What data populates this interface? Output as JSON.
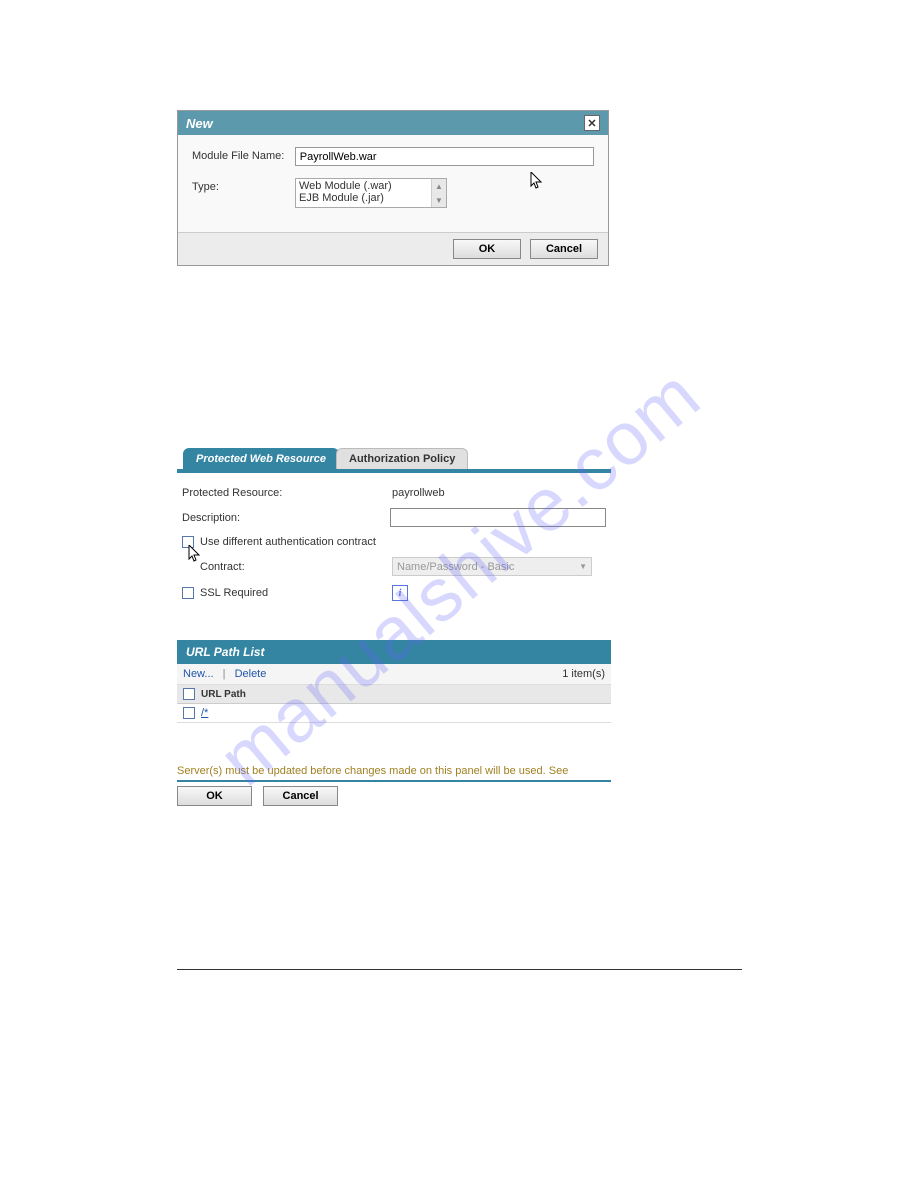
{
  "watermark": "manualshive.com",
  "dialog": {
    "title": "New",
    "fields": {
      "module_file_name": {
        "label": "Module File Name:",
        "value": "PayrollWeb.war"
      },
      "type": {
        "label": "Type:",
        "options": [
          "Web Module (.war)",
          "EJB Module (.jar)"
        ]
      }
    },
    "buttons": {
      "ok": "OK",
      "cancel": "Cancel"
    }
  },
  "tabs": {
    "active": "Protected Web Resource",
    "inactive": "Authorization Policy"
  },
  "resource_form": {
    "protected_resource": {
      "label": "Protected Resource:",
      "value": "payrollweb"
    },
    "description": {
      "label": "Description:",
      "value": ""
    },
    "use_contract": "Use different authentication contract",
    "contract": {
      "label": "Contract:",
      "value": "Name/Password - Basic"
    },
    "ssl": "SSL Required"
  },
  "url_list": {
    "title": "URL Path List",
    "new": "New...",
    "delete": "Delete",
    "count": "1 item(s)",
    "column": "URL Path",
    "row": "/*"
  },
  "notice": "Server(s) must be updated before changes made on this panel will be used. See",
  "actions": {
    "ok": "OK",
    "cancel": "Cancel"
  }
}
